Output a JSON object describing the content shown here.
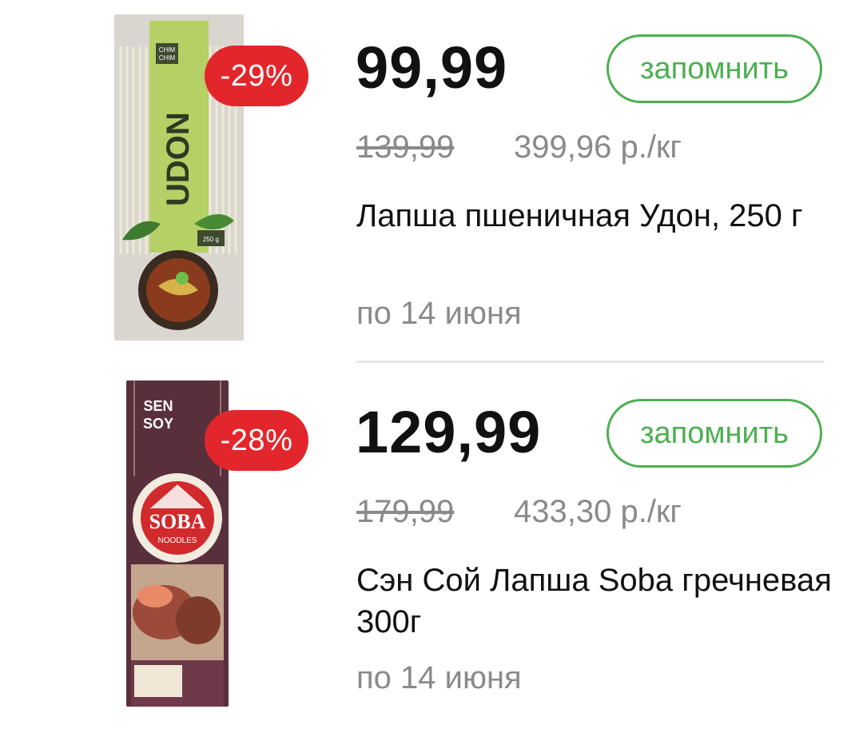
{
  "products": [
    {
      "discount": "-29%",
      "price": "99,99",
      "save_label": "запомнить",
      "old_price": "139,99",
      "unit_price": "399,96 р./кг",
      "name": "Лапша пшеничная Удон, 250 г",
      "valid_until": "по 14 июня",
      "image": {
        "brand_line1": "CHIM",
        "brand_line2": "CHIM",
        "title": "UDON",
        "weight": "250 g"
      }
    },
    {
      "discount": "-28%",
      "price": "129,99",
      "save_label": "запомнить",
      "old_price": "179,99",
      "unit_price": "433,30 р./кг",
      "name": "Сэн Сой Лапша Soba гречневая 300г",
      "valid_until": "по 14 июня",
      "image": {
        "brand_line1": "SEN",
        "brand_line2": "SOY",
        "title": "SOBA",
        "subtitle": "NOODLES"
      }
    }
  ],
  "colors": {
    "badge": "#e3262b",
    "accent": "#4caf50",
    "muted_text": "#8a8a8a",
    "text": "#111111"
  }
}
